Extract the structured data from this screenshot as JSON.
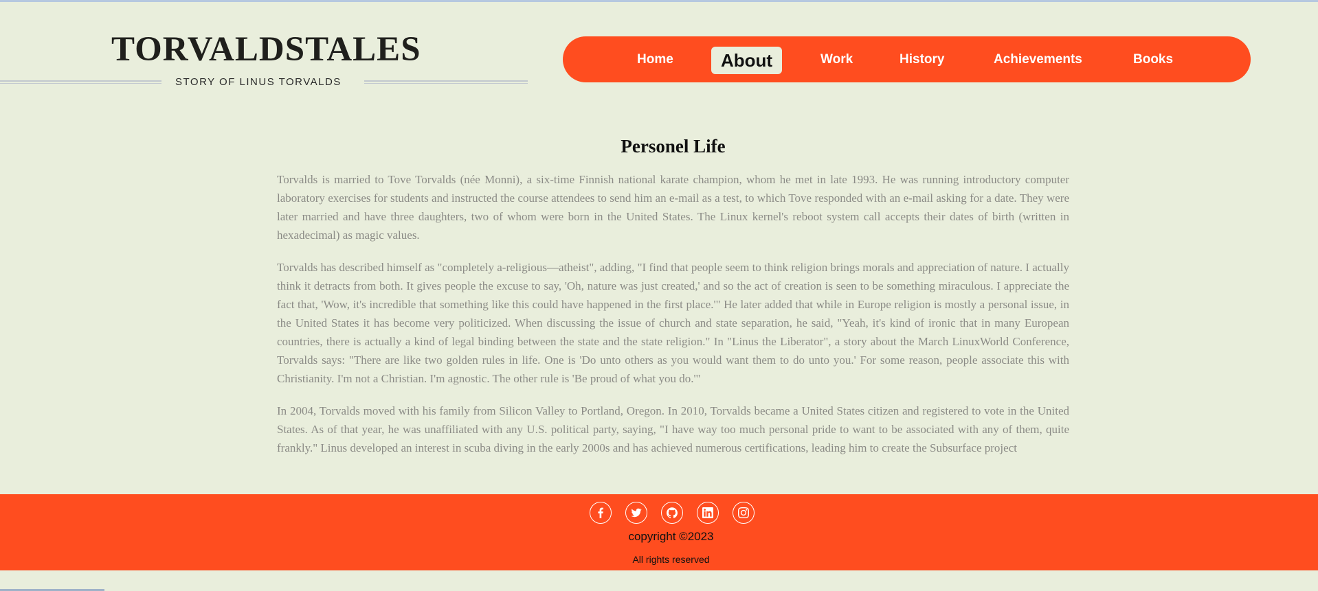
{
  "brand": {
    "title": "TORVALDSTALES",
    "subtitle": "STORY OF LINUS TORVALDS"
  },
  "nav": {
    "items": [
      {
        "label": "Home",
        "active": false
      },
      {
        "label": "About",
        "active": true
      },
      {
        "label": "Work",
        "active": false
      },
      {
        "label": "History",
        "active": false
      },
      {
        "label": "Achievements",
        "active": false
      },
      {
        "label": "Books",
        "active": false
      }
    ]
  },
  "main": {
    "title": "Personel Life",
    "paragraphs": [
      "Torvalds is married to Tove Torvalds (née Monni), a six-time Finnish national karate champion, whom he met in late 1993. He was running introductory computer laboratory exercises for students and instructed the course attendees to send him an e-mail as a test, to which Tove responded with an e-mail asking for a date. They were later married and have three daughters, two of whom were born in the United States. The Linux kernel's reboot system call accepts their dates of birth (written in hexadecimal) as magic values.",
      "Torvalds has described himself as \"completely a-religious—atheist\", adding, \"I find that people seem to think religion brings morals and appreciation of nature. I actually think it detracts from both. It gives people the excuse to say, 'Oh, nature was just created,' and so the act of creation is seen to be something miraculous. I appreciate the fact that, 'Wow, it's incredible that something like this could have happened in the first place.'\" He later added that while in Europe religion is mostly a personal issue, in the United States it has become very politicized. When discussing the issue of church and state separation, he said, \"Yeah, it's kind of ironic that in many European countries, there is actually a kind of legal binding between the state and the state religion.\" In \"Linus the Liberator\", a story about the March LinuxWorld Conference, Torvalds says: \"There are like two golden rules in life. One is 'Do unto others as you would want them to do unto you.' For some reason, people associate this with Christianity. I'm not a Christian. I'm agnostic. The other rule is 'Be proud of what you do.'\"",
      "In 2004, Torvalds moved with his family from Silicon Valley to Portland, Oregon. In 2010, Torvalds became a United States citizen and registered to vote in the United States. As of that year, he was unaffiliated with any U.S. political party, saying, \"I have way too much personal pride to want to be associated with any of them, quite frankly.\" Linus developed an interest in scuba diving in the early 2000s and has achieved numerous certifications, leading him to create the Subsurface project"
    ]
  },
  "footer": {
    "social": [
      "facebook-icon",
      "twitter-icon",
      "github-icon",
      "linkedin-icon",
      "instagram-icon"
    ],
    "copyright": "copyright ©2023",
    "rights": "All rights reserved"
  },
  "colors": {
    "background": "#e9eedc",
    "accent": "#ff4d1f",
    "body_text": "#8b8b86"
  }
}
